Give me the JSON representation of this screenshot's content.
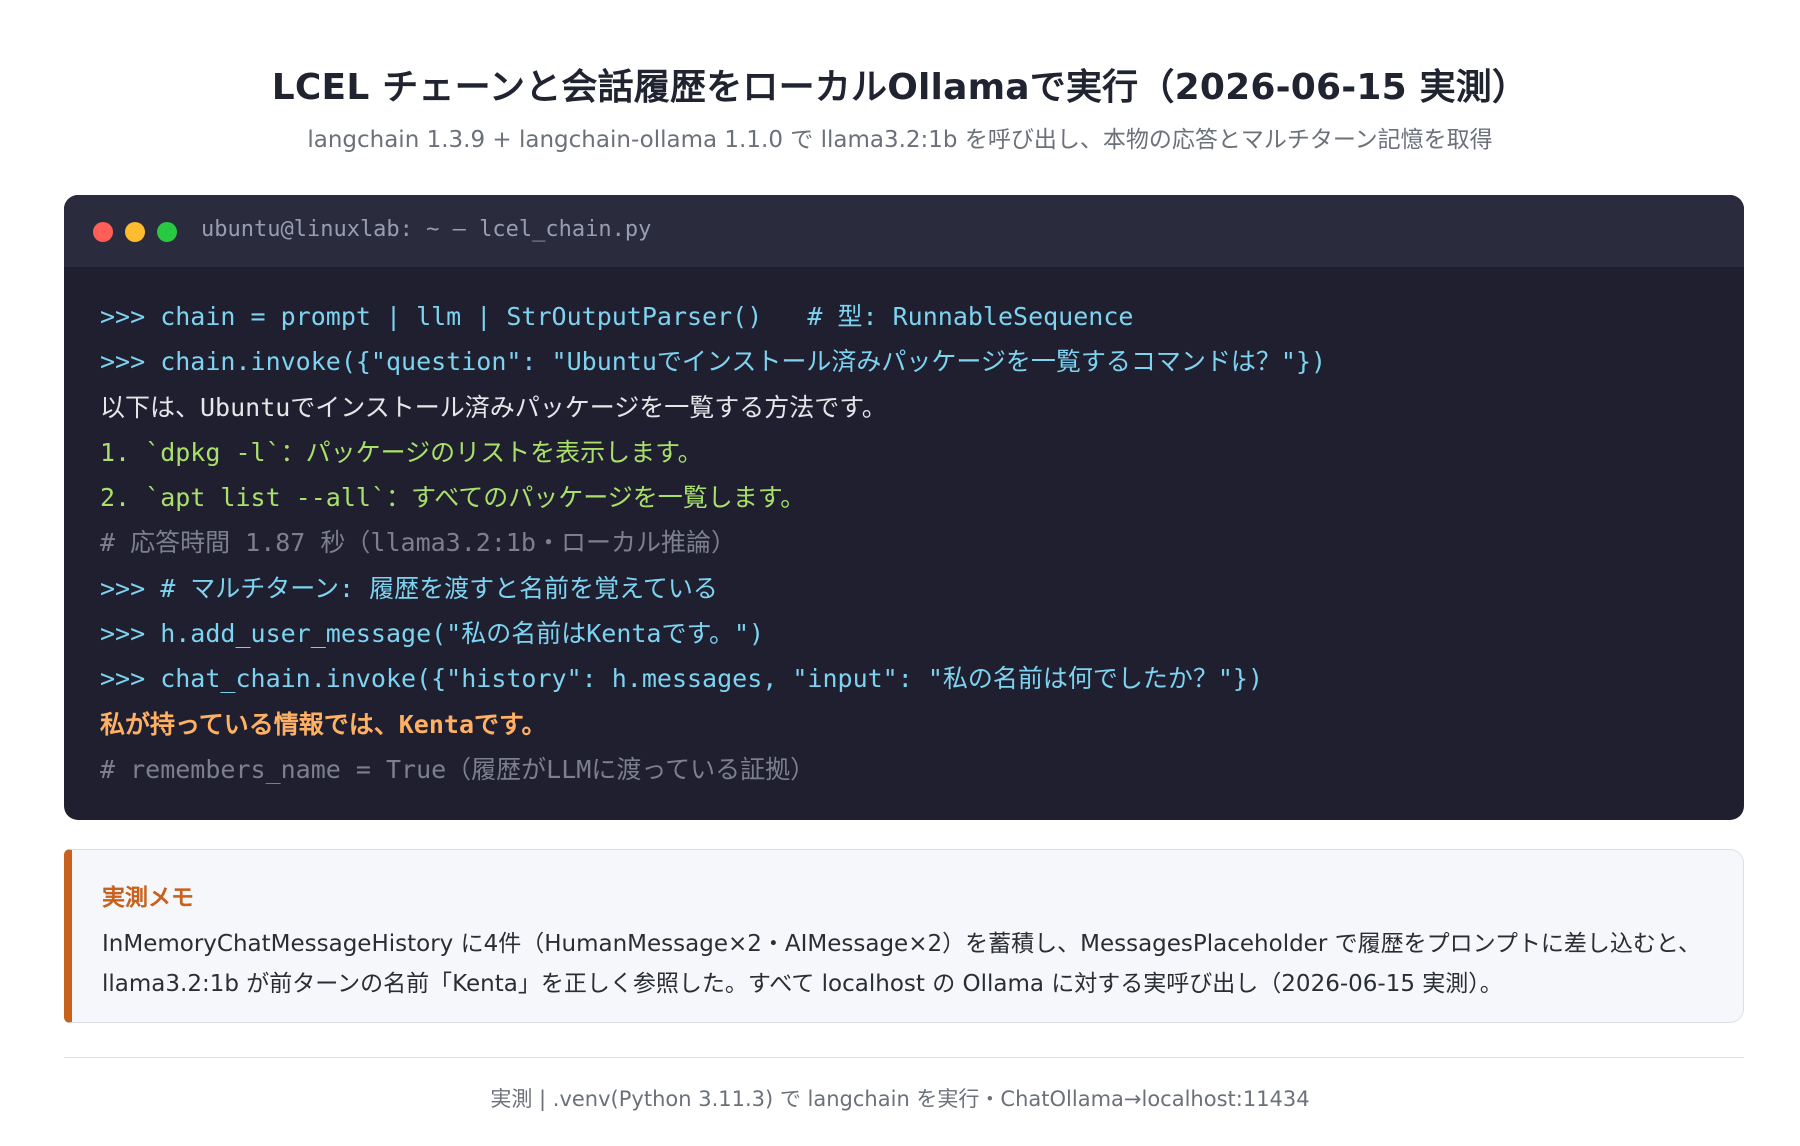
{
  "header": {
    "title": "LCEL チェーンと会話履歴をローカルOllamaで実行（2026-06-15 実測）",
    "subtitle": "langchain 1.3.9 + langchain-ollama 1.1.0 で llama3.2:1b を呼び出し、本物の応答とマルチターン記憶を取得"
  },
  "terminal": {
    "title": "ubuntu@linuxlab: ~ — lcel_chain.py",
    "lines": [
      {
        "kind": "cmd",
        "text": ">>> chain = prompt | llm | StrOutputParser()   # 型: RunnableSequence"
      },
      {
        "kind": "cmd",
        "text": ">>> chain.invoke({\"question\": \"Ubuntuでインストール済みパッケージを一覧するコマンドは？\"})"
      },
      {
        "kind": "out",
        "text": "以下は、Ubuntuでインストール済みパッケージを一覧する方法です。"
      },
      {
        "kind": "list",
        "text": "1. `dpkg -l`：パッケージのリストを表示します。"
      },
      {
        "kind": "list",
        "text": "2. `apt list --all`：すべてのパッケージを一覧します。"
      },
      {
        "kind": "comment",
        "text": "# 応答時間 1.87 秒（llama3.2:1b・ローカル推論）"
      },
      {
        "kind": "cmd",
        "text": ">>> # マルチターン: 履歴を渡すと名前を覚えている"
      },
      {
        "kind": "cmd",
        "text": ">>> h.add_user_message(\"私の名前はKentaです。\")"
      },
      {
        "kind": "cmd",
        "text": ">>> chat_chain.invoke({\"history\": h.messages, \"input\": \"私の名前は何でしたか？\"})"
      },
      {
        "kind": "answer",
        "text": "私が持っている情報では、Kentaです。"
      },
      {
        "kind": "comment",
        "text": "# remembers_name = True（履歴がLLMに渡っている証拠）"
      }
    ]
  },
  "memo": {
    "title": "実測メモ",
    "text": "InMemoryChatMessageHistory に4件（HumanMessage×2・AIMessage×2）を蓄積し、MessagesPlaceholder で履歴をプロンプトに差し込むと、llama3.2:1b が前ターンの名前「Kenta」を正しく参照した。すべて localhost の Ollama に対する実呼び出し（2026-06-15 実測）。"
  },
  "footer": {
    "text": "実測 | .venv(Python 3.11.3) で langchain を実行・ChatOllama→localhost:11434"
  }
}
